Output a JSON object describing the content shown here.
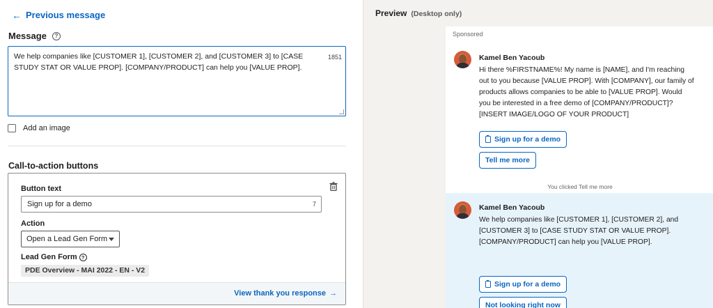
{
  "editor": {
    "back_label": "Previous message",
    "message_label": "Message",
    "message_text": "We help companies like [CUSTOMER 1], [CUSTOMER 2], and [CUSTOMER 3] to [CASE STUDY STAT OR VALUE PROP]. [COMPANY/PRODUCT] can help you [VALUE PROP].",
    "char_count": "1851",
    "add_image_label": "Add an image",
    "cta_heading": "Call-to-action buttons",
    "cta": {
      "button_text_label": "Button text",
      "button_text_value": "Sign up for a demo",
      "button_text_count": "7",
      "action_label": "Action",
      "action_value": "Open a Lead Gen Form",
      "lead_gen_label": "Lead Gen Form",
      "lead_gen_value": "PDE Overview - MAI 2022 - EN - V2",
      "thank_you_link": "View thank you response"
    }
  },
  "preview": {
    "title": "Preview",
    "subtitle": "(Desktop only)",
    "sponsored": "Sponsored",
    "messages": [
      {
        "sender": "Kamel Ben Yacoub",
        "text": "Hi there %FIRSTNAME%! My name is [NAME], and I'm reaching out to you because [VALUE PROP]. With [COMPANY], our family of products allows companies to be able to [VALUE PROP]. Would you be interested in a free demo of [COMPANY/PRODUCT]? [INSERT IMAGE/LOGO OF YOUR PRODUCT]",
        "buttons": [
          "Sign up for a demo",
          "Tell me more"
        ]
      },
      {
        "sender": "Kamel Ben Yacoub",
        "text": "We help companies like [CUSTOMER 1], [CUSTOMER 2], and [CUSTOMER 3] to [CASE STUDY STAT OR VALUE PROP]. [COMPANY/PRODUCT] can help you [VALUE PROP].",
        "buttons": [
          "Sign up for a demo",
          "Not looking right now"
        ]
      }
    ],
    "clicked_note": "You clicked Tell me more"
  },
  "colors": {
    "accent": "#0a66c2",
    "highlight": "#e7f3fb",
    "panel_bg": "#f3f2ef"
  },
  "icons": [
    "arrow-left-icon",
    "help-icon",
    "trash-icon",
    "chevron-down-icon",
    "arrow-right-icon",
    "document-icon"
  ]
}
